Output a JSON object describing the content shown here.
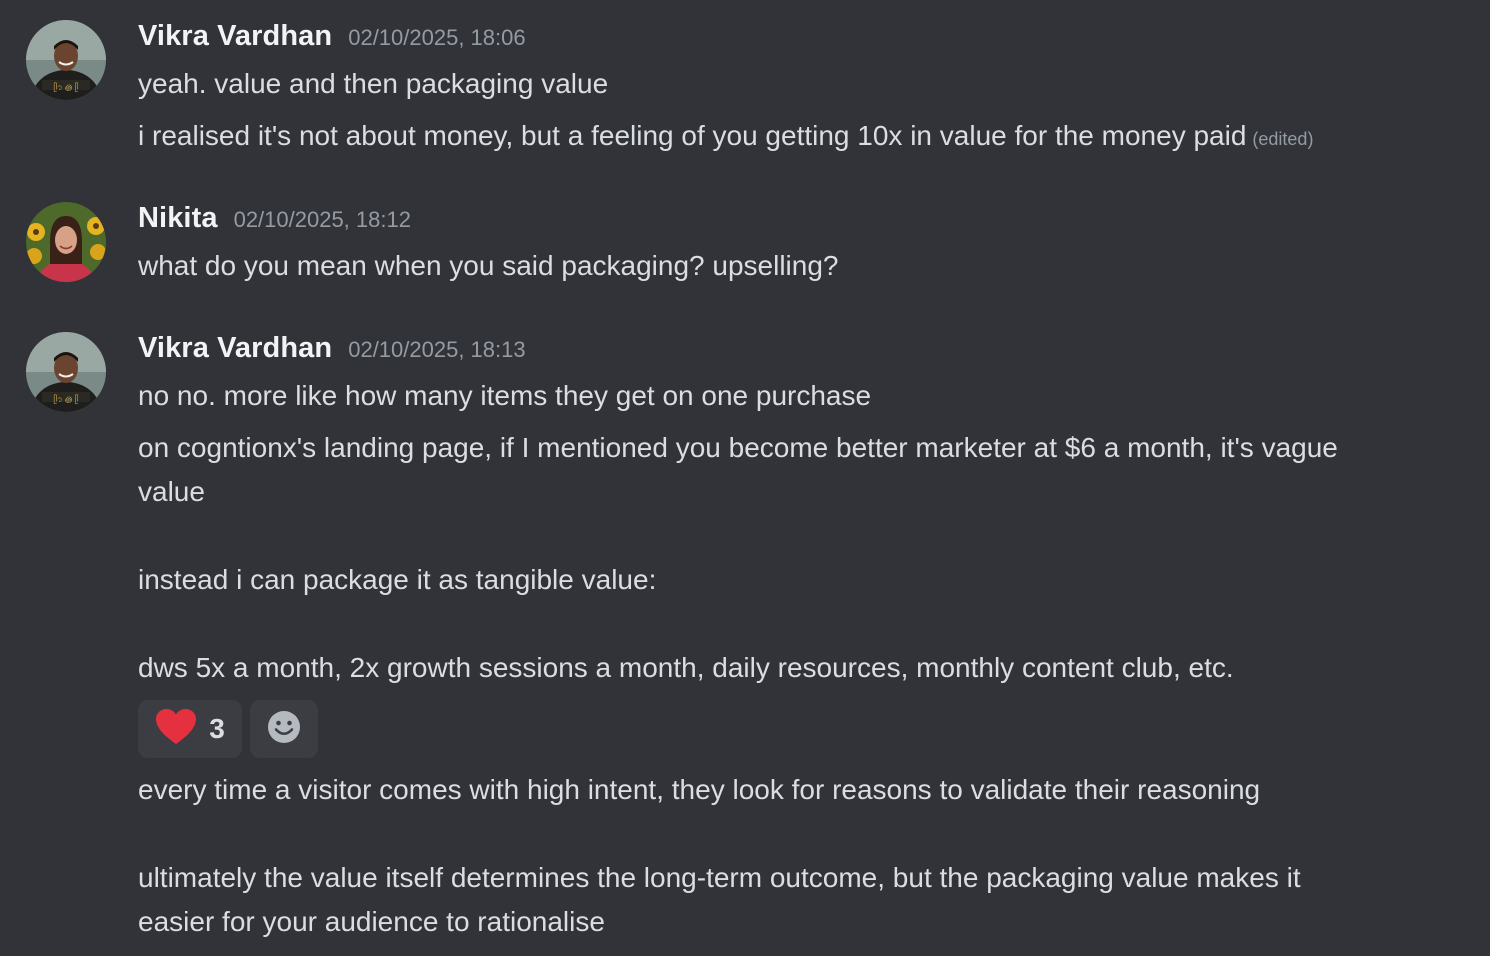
{
  "messages": [
    {
      "author": "Vikra Vardhan",
      "timestamp": "02/10/2025, 18:06",
      "avatar_icon": "avatar-vikra",
      "lines": [
        "yeah. value and then packaging value",
        "i realised it's not about money, but a feeling of you getting 10x in value for the money paid"
      ],
      "edited_label": "(edited)"
    },
    {
      "author": "Nikita",
      "timestamp": "02/10/2025, 18:12",
      "avatar_icon": "avatar-nikita",
      "lines": [
        "what do you mean when you said packaging? upselling?"
      ]
    },
    {
      "author": "Vikra Vardhan",
      "timestamp": "02/10/2025, 18:13",
      "avatar_icon": "avatar-vikra",
      "lines": [
        "no no. more like how many items they get on one purchase",
        "on cogntionx's landing page, if I mentioned you become better marketer at $6 a month, it's vague",
        "value",
        "",
        "instead i can package it as tangible value:",
        "",
        "dws 5x a month, 2x growth sessions a month, daily resources, monthly content club, etc."
      ],
      "reactions": [
        {
          "emoji": "heart-icon",
          "count": "3",
          "color": "#e5303f"
        }
      ],
      "add_reaction_icon": "add-reaction-icon",
      "lines_after": [
        "every time a visitor comes with high intent, they look for reasons to validate their reasoning",
        "",
        "ultimately the value itself determines the long-term outcome, but the packaging value makes it",
        "easier for your audience to rationalise"
      ]
    }
  ],
  "colors": {
    "background": "#313338",
    "username": "#f2f3f5",
    "text": "#dbdee1",
    "muted": "#949ba4",
    "reaction_bg": "#3b3d43"
  }
}
